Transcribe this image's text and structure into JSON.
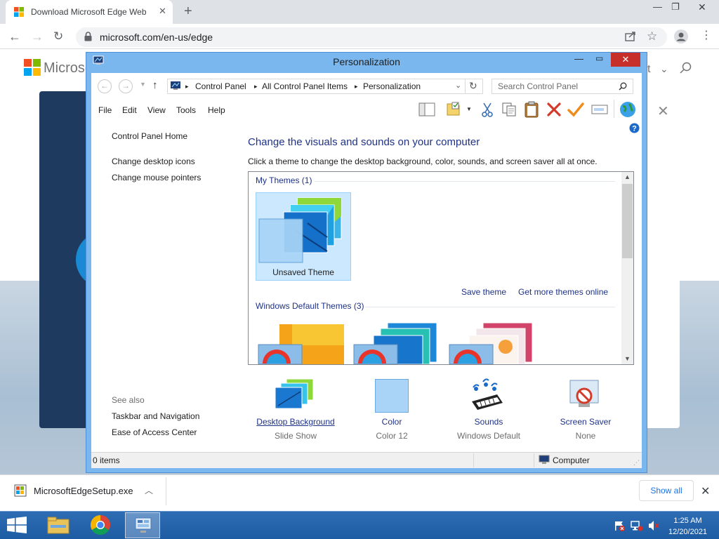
{
  "browser": {
    "tab_title": "Download Microsoft Edge Web B",
    "url": "microsoft.com/en-us/edge",
    "background_site_text": "Microsof",
    "background_partial_text": "t"
  },
  "download_bar": {
    "file_name": "MicrosoftEdgeSetup.exe",
    "show_all": "Show all"
  },
  "window": {
    "title": "Personalization",
    "breadcrumb": [
      "Control Panel",
      "All Control Panel Items",
      "Personalization"
    ],
    "search_placeholder": "Search Control Panel",
    "menu": [
      "File",
      "Edit",
      "View",
      "Tools",
      "Help"
    ]
  },
  "left_pane": {
    "home": "Control Panel Home",
    "links": [
      "Change desktop icons",
      "Change mouse pointers"
    ],
    "see_also_label": "See also",
    "see_also": [
      "Taskbar and Navigation",
      "Ease of Access Center"
    ]
  },
  "main": {
    "heading": "Change the visuals and sounds on your computer",
    "subheading": "Click a theme to change the desktop background, color, sounds, and screen saver all at once.",
    "my_themes_label": "My Themes (1)",
    "selected_theme_name": "Unsaved Theme",
    "save_theme": "Save theme",
    "get_more": "Get more themes online",
    "default_themes_label": "Windows Default Themes (3)"
  },
  "bottom_items": [
    {
      "label": "Desktop Background",
      "value": "Slide Show"
    },
    {
      "label": "Color",
      "value": "Color 12"
    },
    {
      "label": "Sounds",
      "value": "Windows Default"
    },
    {
      "label": "Screen Saver",
      "value": "None"
    }
  ],
  "status": {
    "items": "0 items",
    "location": "Computer"
  },
  "taskbar": {
    "time": "1:25 AM",
    "date": "12/20/2021"
  },
  "colors": {
    "window_frame": "#7ab7ef",
    "link_blue": "#1e3287",
    "taskbar": "#1d5ba3",
    "close_red": "#c7302a"
  }
}
